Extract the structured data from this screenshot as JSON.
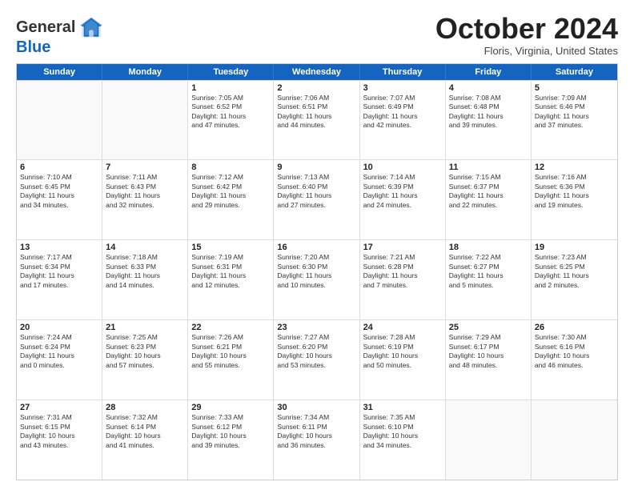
{
  "header": {
    "logo_general": "General",
    "logo_blue": "Blue",
    "month_title": "October 2024",
    "subtitle": "Floris, Virginia, United States"
  },
  "weekdays": [
    "Sunday",
    "Monday",
    "Tuesday",
    "Wednesday",
    "Thursday",
    "Friday",
    "Saturday"
  ],
  "rows": [
    [
      {
        "day": "",
        "lines": [],
        "empty": true
      },
      {
        "day": "",
        "lines": [],
        "empty": true
      },
      {
        "day": "1",
        "lines": [
          "Sunrise: 7:05 AM",
          "Sunset: 6:52 PM",
          "Daylight: 11 hours",
          "and 47 minutes."
        ]
      },
      {
        "day": "2",
        "lines": [
          "Sunrise: 7:06 AM",
          "Sunset: 6:51 PM",
          "Daylight: 11 hours",
          "and 44 minutes."
        ]
      },
      {
        "day": "3",
        "lines": [
          "Sunrise: 7:07 AM",
          "Sunset: 6:49 PM",
          "Daylight: 11 hours",
          "and 42 minutes."
        ]
      },
      {
        "day": "4",
        "lines": [
          "Sunrise: 7:08 AM",
          "Sunset: 6:48 PM",
          "Daylight: 11 hours",
          "and 39 minutes."
        ]
      },
      {
        "day": "5",
        "lines": [
          "Sunrise: 7:09 AM",
          "Sunset: 6:46 PM",
          "Daylight: 11 hours",
          "and 37 minutes."
        ]
      }
    ],
    [
      {
        "day": "6",
        "lines": [
          "Sunrise: 7:10 AM",
          "Sunset: 6:45 PM",
          "Daylight: 11 hours",
          "and 34 minutes."
        ]
      },
      {
        "day": "7",
        "lines": [
          "Sunrise: 7:11 AM",
          "Sunset: 6:43 PM",
          "Daylight: 11 hours",
          "and 32 minutes."
        ]
      },
      {
        "day": "8",
        "lines": [
          "Sunrise: 7:12 AM",
          "Sunset: 6:42 PM",
          "Daylight: 11 hours",
          "and 29 minutes."
        ]
      },
      {
        "day": "9",
        "lines": [
          "Sunrise: 7:13 AM",
          "Sunset: 6:40 PM",
          "Daylight: 11 hours",
          "and 27 minutes."
        ]
      },
      {
        "day": "10",
        "lines": [
          "Sunrise: 7:14 AM",
          "Sunset: 6:39 PM",
          "Daylight: 11 hours",
          "and 24 minutes."
        ]
      },
      {
        "day": "11",
        "lines": [
          "Sunrise: 7:15 AM",
          "Sunset: 6:37 PM",
          "Daylight: 11 hours",
          "and 22 minutes."
        ]
      },
      {
        "day": "12",
        "lines": [
          "Sunrise: 7:16 AM",
          "Sunset: 6:36 PM",
          "Daylight: 11 hours",
          "and 19 minutes."
        ]
      }
    ],
    [
      {
        "day": "13",
        "lines": [
          "Sunrise: 7:17 AM",
          "Sunset: 6:34 PM",
          "Daylight: 11 hours",
          "and 17 minutes."
        ]
      },
      {
        "day": "14",
        "lines": [
          "Sunrise: 7:18 AM",
          "Sunset: 6:33 PM",
          "Daylight: 11 hours",
          "and 14 minutes."
        ]
      },
      {
        "day": "15",
        "lines": [
          "Sunrise: 7:19 AM",
          "Sunset: 6:31 PM",
          "Daylight: 11 hours",
          "and 12 minutes."
        ]
      },
      {
        "day": "16",
        "lines": [
          "Sunrise: 7:20 AM",
          "Sunset: 6:30 PM",
          "Daylight: 11 hours",
          "and 10 minutes."
        ]
      },
      {
        "day": "17",
        "lines": [
          "Sunrise: 7:21 AM",
          "Sunset: 6:28 PM",
          "Daylight: 11 hours",
          "and 7 minutes."
        ]
      },
      {
        "day": "18",
        "lines": [
          "Sunrise: 7:22 AM",
          "Sunset: 6:27 PM",
          "Daylight: 11 hours",
          "and 5 minutes."
        ]
      },
      {
        "day": "19",
        "lines": [
          "Sunrise: 7:23 AM",
          "Sunset: 6:25 PM",
          "Daylight: 11 hours",
          "and 2 minutes."
        ]
      }
    ],
    [
      {
        "day": "20",
        "lines": [
          "Sunrise: 7:24 AM",
          "Sunset: 6:24 PM",
          "Daylight: 11 hours",
          "and 0 minutes."
        ]
      },
      {
        "day": "21",
        "lines": [
          "Sunrise: 7:25 AM",
          "Sunset: 6:23 PM",
          "Daylight: 10 hours",
          "and 57 minutes."
        ]
      },
      {
        "day": "22",
        "lines": [
          "Sunrise: 7:26 AM",
          "Sunset: 6:21 PM",
          "Daylight: 10 hours",
          "and 55 minutes."
        ]
      },
      {
        "day": "23",
        "lines": [
          "Sunrise: 7:27 AM",
          "Sunset: 6:20 PM",
          "Daylight: 10 hours",
          "and 53 minutes."
        ]
      },
      {
        "day": "24",
        "lines": [
          "Sunrise: 7:28 AM",
          "Sunset: 6:19 PM",
          "Daylight: 10 hours",
          "and 50 minutes."
        ]
      },
      {
        "day": "25",
        "lines": [
          "Sunrise: 7:29 AM",
          "Sunset: 6:17 PM",
          "Daylight: 10 hours",
          "and 48 minutes."
        ]
      },
      {
        "day": "26",
        "lines": [
          "Sunrise: 7:30 AM",
          "Sunset: 6:16 PM",
          "Daylight: 10 hours",
          "and 46 minutes."
        ]
      }
    ],
    [
      {
        "day": "27",
        "lines": [
          "Sunrise: 7:31 AM",
          "Sunset: 6:15 PM",
          "Daylight: 10 hours",
          "and 43 minutes."
        ]
      },
      {
        "day": "28",
        "lines": [
          "Sunrise: 7:32 AM",
          "Sunset: 6:14 PM",
          "Daylight: 10 hours",
          "and 41 minutes."
        ]
      },
      {
        "day": "29",
        "lines": [
          "Sunrise: 7:33 AM",
          "Sunset: 6:12 PM",
          "Daylight: 10 hours",
          "and 39 minutes."
        ]
      },
      {
        "day": "30",
        "lines": [
          "Sunrise: 7:34 AM",
          "Sunset: 6:11 PM",
          "Daylight: 10 hours",
          "and 36 minutes."
        ]
      },
      {
        "day": "31",
        "lines": [
          "Sunrise: 7:35 AM",
          "Sunset: 6:10 PM",
          "Daylight: 10 hours",
          "and 34 minutes."
        ]
      },
      {
        "day": "",
        "lines": [],
        "empty": true
      },
      {
        "day": "",
        "lines": [],
        "empty": true
      }
    ]
  ]
}
